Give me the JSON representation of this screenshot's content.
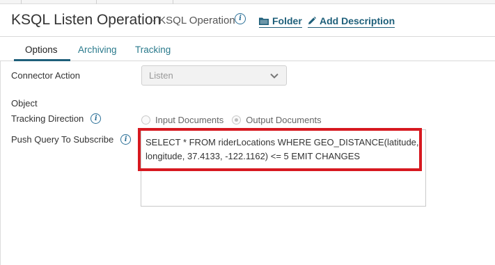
{
  "header": {
    "title": "KSQL Listen Operation",
    "subtitle": "- KSQL Operation",
    "folder_link": "Folder",
    "description_link": "Add Description"
  },
  "tabs": [
    {
      "label": "Options",
      "active": true
    },
    {
      "label": "Archiving",
      "active": false
    },
    {
      "label": "Tracking",
      "active": false
    }
  ],
  "form": {
    "connector_action": {
      "label": "Connector Action",
      "value": "Listen"
    },
    "object": {
      "label": "Object"
    },
    "tracking_direction": {
      "label": "Tracking Direction",
      "options": [
        "Input Documents",
        "Output Documents"
      ],
      "selected": "Output Documents"
    },
    "push_query": {
      "label": "Push Query To Subscribe",
      "value": "SELECT * FROM riderLocations WHERE GEO_DISTANCE(latitude, longitude, 37.4133, -122.1162) <= 5 EMIT CHANGES"
    }
  },
  "colors": {
    "accent": "#1e5f7a",
    "tab_link": "#2a7a8c",
    "highlight": "#d71920"
  },
  "icons": [
    "info-icon",
    "folder-icon",
    "pencil-icon",
    "chevron-down-icon"
  ]
}
